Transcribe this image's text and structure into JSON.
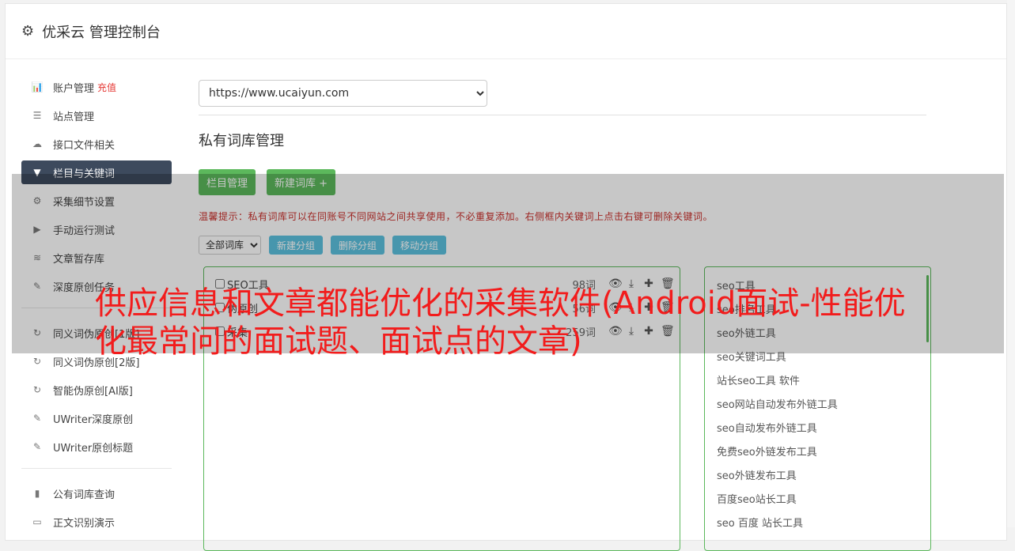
{
  "header": {
    "title": "优采云 管理控制台",
    "icon": "gear-icon"
  },
  "sidebar": {
    "items": [
      {
        "label": "账户管理",
        "badge": "充值",
        "icon": "bar-chart-icon",
        "glyph": "📊"
      },
      {
        "label": "站点管理",
        "icon": "server-icon",
        "glyph": "☰"
      },
      {
        "label": "接口文件相关",
        "icon": "cloud-upload-icon",
        "glyph": "☁"
      },
      {
        "label": "栏目与关键词",
        "icon": "filter-icon",
        "glyph": "▼",
        "active": true
      },
      {
        "label": "采集细节设置",
        "icon": "cogs-icon",
        "glyph": "⚙"
      },
      {
        "label": "手动运行测试",
        "icon": "play-circle-icon",
        "glyph": "▶"
      },
      {
        "label": "文章暂存库",
        "icon": "database-icon",
        "glyph": "≋"
      },
      {
        "label": "深度原创任务",
        "icon": "edit-icon",
        "glyph": "✎"
      }
    ],
    "items2": [
      {
        "label": "同义词伪原创[1版]",
        "icon": "refresh-icon",
        "glyph": "↻"
      },
      {
        "label": "同义词伪原创[2版]",
        "icon": "refresh-icon",
        "glyph": "↻"
      },
      {
        "label": "智能伪原创[AI版]",
        "icon": "refresh-icon",
        "glyph": "↻"
      },
      {
        "label": "UWriter深度原创",
        "icon": "edit-icon",
        "glyph": "✎"
      },
      {
        "label": "UWriter原创标题",
        "icon": "edit-icon",
        "glyph": "✎"
      }
    ],
    "items3": [
      {
        "label": "公有词库查询",
        "icon": "book-icon",
        "glyph": "▮"
      },
      {
        "label": "正文识别演示",
        "icon": "monitor-icon",
        "glyph": "▭"
      }
    ]
  },
  "main": {
    "site_select": "https://www.ucaiyun.com",
    "section_title": "私有词库管理",
    "btn_column": "栏目管理",
    "btn_new_lib": "新建词库 +",
    "tip": "温馨提示：私有词库可以在同账号不同网站之间共享使用，不必重复添加。右侧框内关键词上点击右键可删除关键词。",
    "group_select": "全部词库",
    "btn_new_group": "新建分组",
    "btn_del_group": "删除分组",
    "btn_move_group": "移动分组",
    "libraries": [
      {
        "name": "SEO工具",
        "count": "98词"
      },
      {
        "name": "伪原创",
        "count": "56词"
      },
      {
        "name": "采集",
        "count": "259词"
      }
    ],
    "keywords": [
      "seo工具",
      "seo排名工具",
      "seo外链工具",
      "seo关键词工具",
      "站长seo工具 软件",
      "seo网站自动发布外链工具",
      "seo自动发布外链工具",
      "免费seo外链发布工具",
      "seo外链发布工具",
      "百度seo站长工具",
      "seo 百度 站长工具"
    ]
  },
  "overlay_title": "供应信息和文章都能优化的采集软件(Android面试-性能优化最常问的面试题、面试点的文章)"
}
